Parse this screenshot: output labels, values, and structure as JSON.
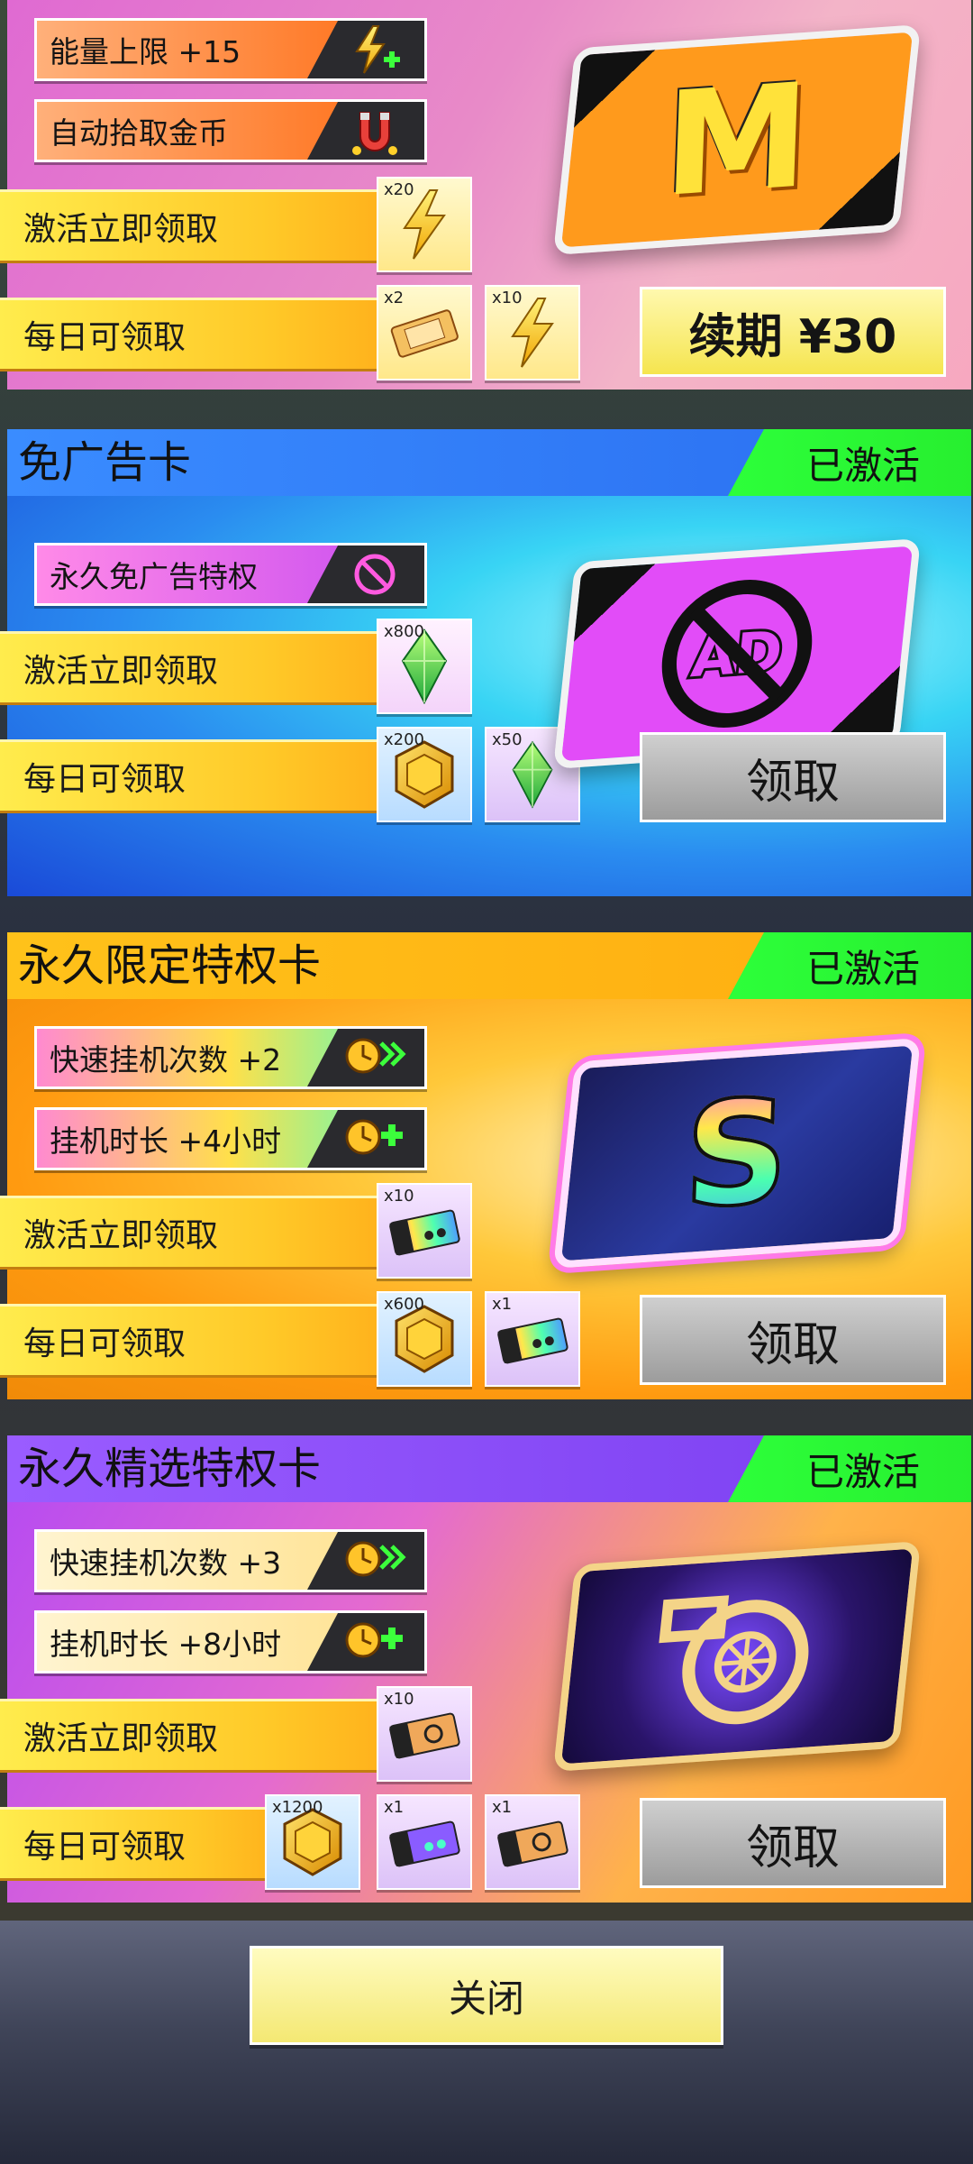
{
  "monthly_card": {
    "perks": [
      {
        "label": "能量上限 +15",
        "icon": "energy-plus-icon"
      },
      {
        "label": "自动拾取金币",
        "icon": "coin-magnet-icon"
      }
    ],
    "activate_label": "激活立即领取",
    "activate_rewards": [
      {
        "qty": "x20",
        "icon": "energy-bolt-icon"
      }
    ],
    "daily_label": "每日可领取",
    "daily_rewards": [
      {
        "qty": "x2",
        "icon": "speed-hunter-ticket-icon"
      },
      {
        "qty": "x10",
        "icon": "energy-bolt-icon"
      }
    ],
    "art_letter": "M",
    "renew_label": "续期 ¥30"
  },
  "no_ads_card": {
    "title": "免广告卡",
    "status": "已激活",
    "perks": [
      {
        "label": "永久免广告特权",
        "icon": "no-ad-icon"
      }
    ],
    "activate_label": "激活立即领取",
    "activate_rewards": [
      {
        "qty": "x800",
        "icon": "green-gem-icon"
      }
    ],
    "daily_label": "每日可领取",
    "daily_rewards": [
      {
        "qty": "x200",
        "icon": "gold-hex-coin-icon"
      },
      {
        "qty": "x50",
        "icon": "green-gem-icon"
      }
    ],
    "art_text": "AD",
    "claim_label": "领取"
  },
  "limited_card": {
    "title": "永久限定特权卡",
    "status": "已激活",
    "perks": [
      {
        "label": "快速挂机次数 +2",
        "icon": "fast-idle-icon"
      },
      {
        "label": "挂机时长 +4小时",
        "icon": "idle-duration-icon"
      }
    ],
    "activate_label": "激活立即领取",
    "activate_rewards": [
      {
        "qty": "x10",
        "icon": "rainbow-ticket-icon"
      }
    ],
    "daily_label": "每日可领取",
    "daily_rewards": [
      {
        "qty": "x600",
        "icon": "gold-hex-coin-icon"
      },
      {
        "qty": "x1",
        "icon": "rainbow-ticket-icon"
      }
    ],
    "art_letter": "S",
    "claim_label": "领取"
  },
  "premium_card": {
    "title": "永久精选特权卡",
    "status": "已激活",
    "perks": [
      {
        "label": "快速挂机次数 +3",
        "icon": "fast-idle-icon"
      },
      {
        "label": "挂机时长 +8小时",
        "icon": "idle-duration-icon"
      }
    ],
    "activate_label": "激活立即领取",
    "activate_rewards": [
      {
        "qty": "x10",
        "icon": "gold-ticket-icon"
      }
    ],
    "daily_label": "每日可领取",
    "daily_rewards": [
      {
        "qty": "x1200",
        "icon": "gold-hex-coin-icon"
      },
      {
        "qty": "x1",
        "icon": "purple-ticket-icon"
      },
      {
        "qty": "x1",
        "icon": "gold-ticket-icon"
      }
    ],
    "art_icon": "turbo-icon",
    "claim_label": "领取"
  },
  "close_label": "关闭",
  "colors": {
    "active_green": "#2dff3a",
    "row_yellow": "#ffc928",
    "claim_gray": "#b5b5b5",
    "close_yellow": "#f4e873"
  }
}
